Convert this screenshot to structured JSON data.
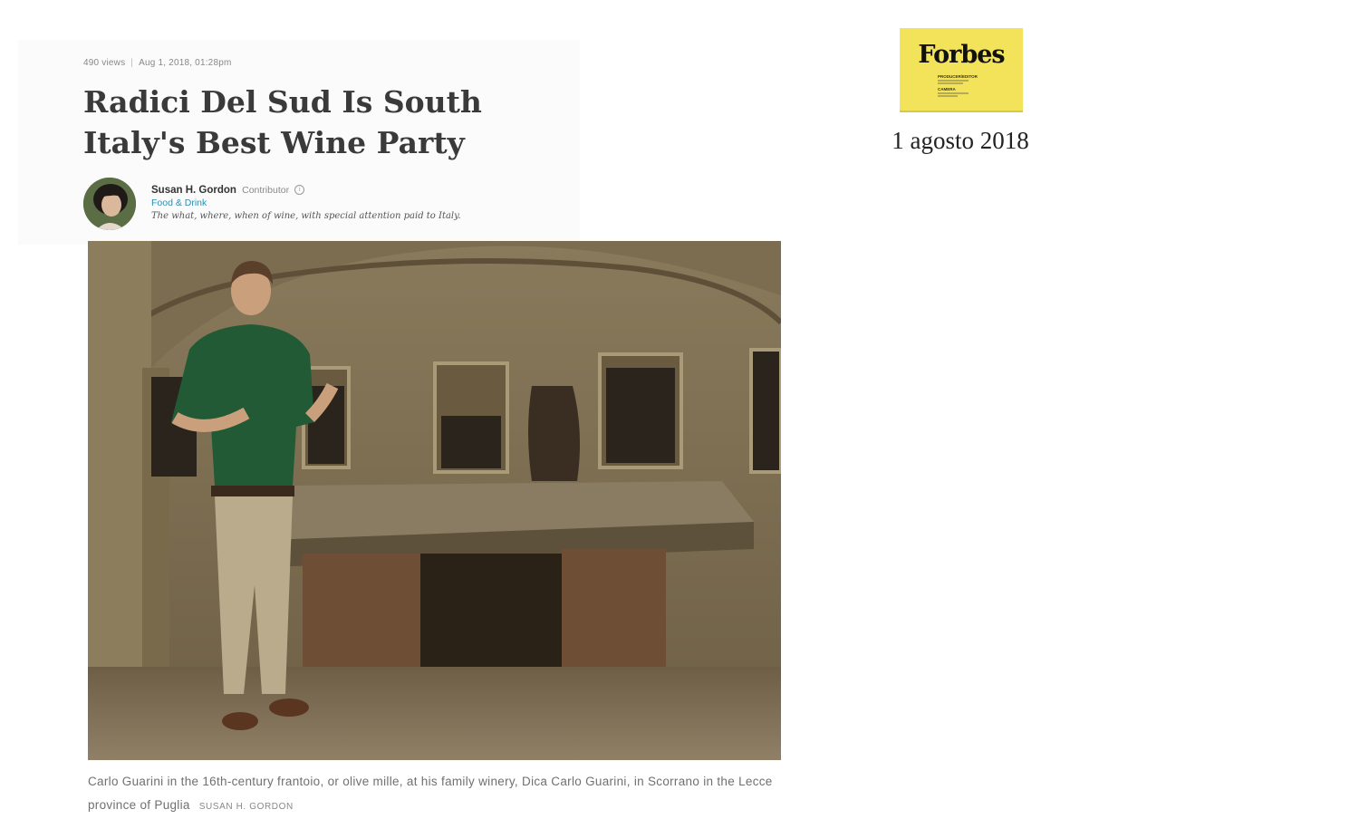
{
  "article": {
    "views": "490 views",
    "separator": "|",
    "published": "Aug 1, 2018, 01:28pm",
    "title": "Radici Del Sud Is South Italy's Best Wine Party",
    "author": {
      "name": "Susan H. Gordon",
      "role": "Contributor",
      "channel": "Food & Drink",
      "tagline": "The what, where, when of wine, with special attention paid to Italy."
    },
    "photo": {
      "caption": "Carlo Guarini in the 16th-century frantoio, or olive mille, at his family winery, Dica Carlo Guarini, in Scorrano in the Lecce province of Puglia",
      "credit": "SUSAN H. GORDON"
    }
  },
  "publication": {
    "logo_text": "Forbes",
    "logo_credit_labels": [
      "PRODUCER/EDITOR",
      "CAMERA"
    ],
    "logo_color": "#f2e35a",
    "date": "1 agosto 2018"
  },
  "colors": {
    "headline": "#3a3a3a",
    "channel_link": "#2a8fb0",
    "caption": "#707070"
  }
}
